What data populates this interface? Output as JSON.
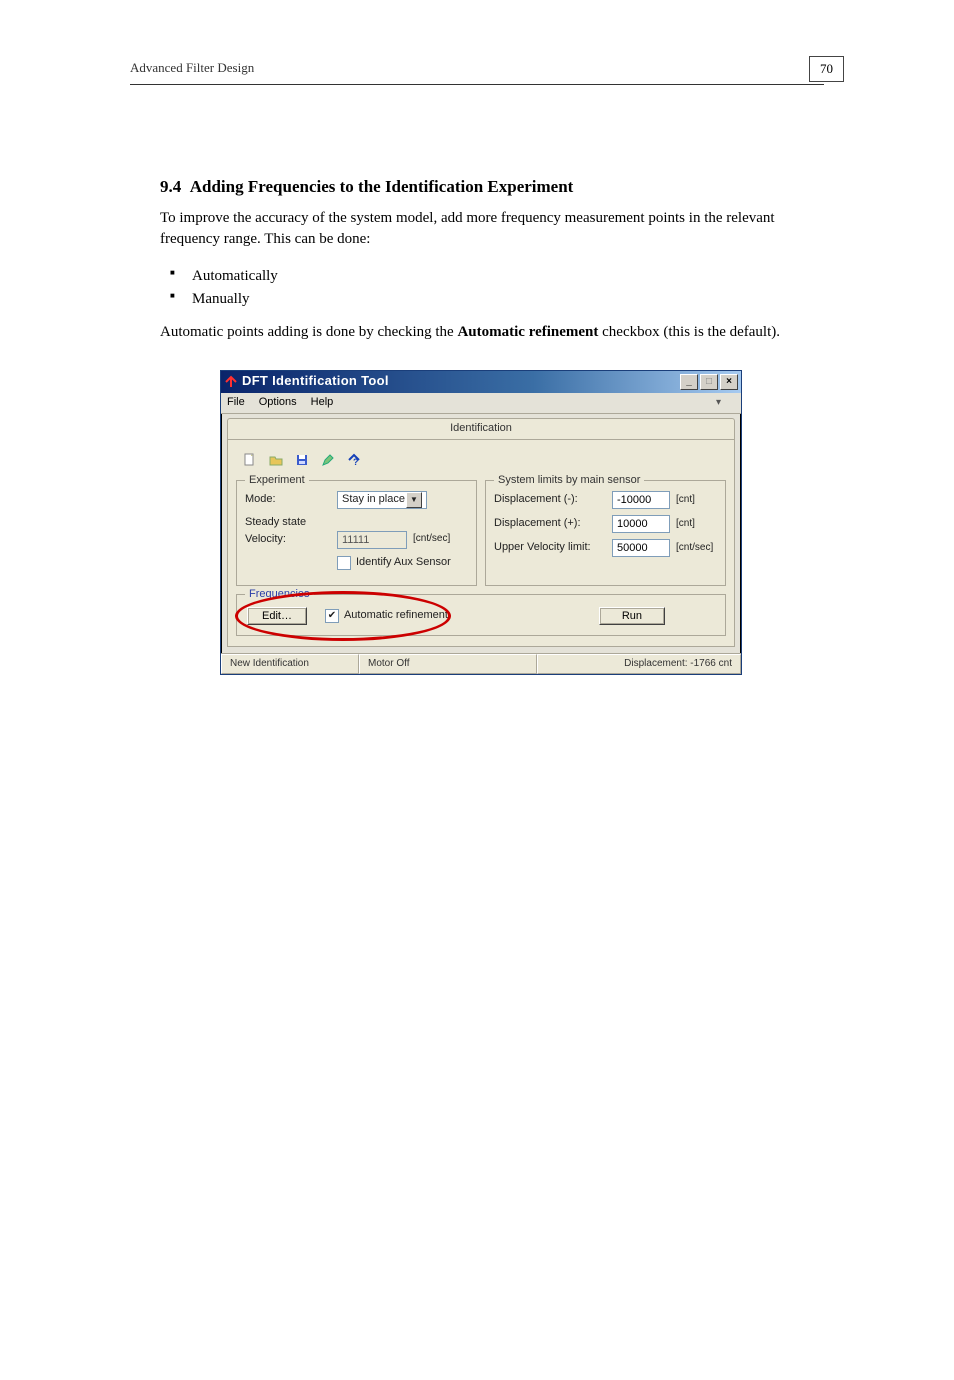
{
  "header": {
    "left": "Advanced Filter Design",
    "page_no": "70"
  },
  "doc": {
    "section_no": "9.4",
    "section_title": "Adding Frequencies to the Identification Experiment",
    "p1": "To improve the accuracy of the system model, add more frequency measurement points in the relevant frequency range. This can be done:",
    "b1": "Automatically",
    "b2": "Manually",
    "p2_a": "Automatic points adding is done by checking the ",
    "p2_b": "Automatic refinement",
    "p2_c": " checkbox (this is the default)."
  },
  "win": {
    "title": "DFT Identification Tool",
    "menu": {
      "file": "File",
      "options": "Options",
      "help": "Help"
    },
    "tab": "Identification",
    "exp": {
      "legend": "Experiment",
      "mode_lbl": "Mode:",
      "mode_val": "Stay in place",
      "ss_lbl": "Steady state",
      "vel_lbl": "Velocity:",
      "vel_val": "11111",
      "vel_unit": "[cnt/sec]",
      "aux": "Identify Aux Sensor"
    },
    "limits": {
      "legend": "System limits by main sensor",
      "dn_lbl": "Displacement (-):",
      "dn_val": "-10000",
      "dn_unit": "[cnt]",
      "dp_lbl": "Displacement (+):",
      "dp_val": "10000",
      "dp_unit": "[cnt]",
      "uv_lbl": "Upper Velocity limit:",
      "uv_val": "50000",
      "uv_unit": "[cnt/sec]"
    },
    "freq": {
      "legend": "Frequencies",
      "edit": "Edit…",
      "auto": "Automatic refinement",
      "run": "Run"
    },
    "status": {
      "a": "New Identification",
      "b": "Motor Off",
      "c": "Displacement: -1766 cnt"
    }
  }
}
